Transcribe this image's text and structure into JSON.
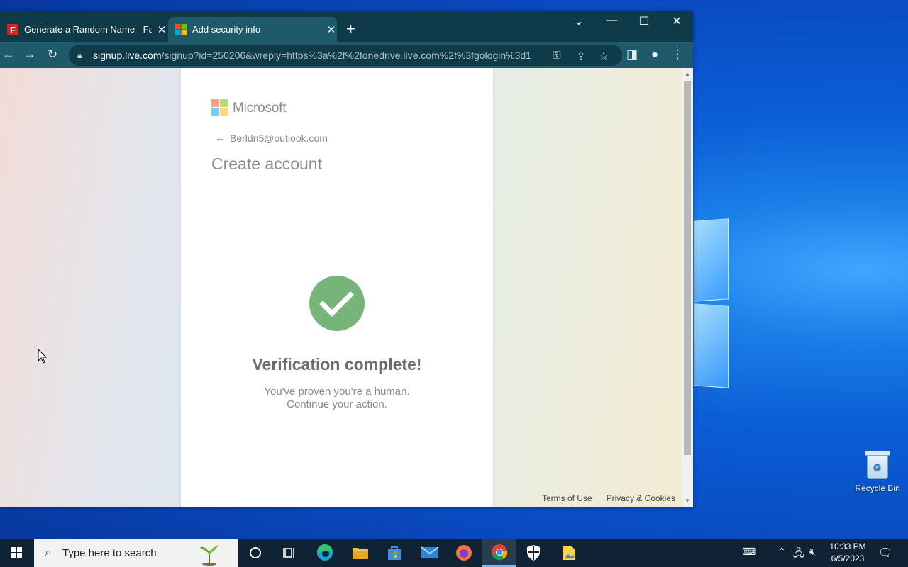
{
  "browser": {
    "tabs": [
      {
        "title": "Generate a Random Name - Fake",
        "favicon": "fakenamegenerator-icon",
        "active": false
      },
      {
        "title": "Add security info",
        "favicon": "microsoft-icon",
        "active": true
      }
    ],
    "url_host": "signup.live.com",
    "url_rest": "/signup?id=250206&wreply=https%3a%2f%2fonedrive.live.com%2f%3fgologin%3d1..."
  },
  "page": {
    "brand": "Microsoft",
    "email": "Berldn5@outlook.com",
    "title": "Create account",
    "verify_title": "Verification complete!",
    "verify_line1": "You've proven you're a human.",
    "verify_line2": "Continue your action.",
    "footer_terms": "Terms of Use",
    "footer_privacy": "Privacy & Cookies",
    "check_color": "#76b47a"
  },
  "desktop": {
    "recycle_bin_label": "Recycle Bin"
  },
  "taskbar": {
    "search_placeholder": "Type here to search",
    "time": "10:33 PM",
    "date": "6/5/2023",
    "apps": [
      "cortana-icon",
      "task-view-icon",
      "edge-icon",
      "file-explorer-icon",
      "store-icon",
      "mail-icon",
      "firefox-icon",
      "chrome-icon",
      "security-icon",
      "app-icon"
    ]
  },
  "colors": {
    "tabstrip": "#0e3a49",
    "toolbar": "#1f5a6a",
    "taskbar": "#0f2335",
    "ms_red": "#f25022",
    "ms_green": "#7fba00",
    "ms_blue": "#00a4ef",
    "ms_yellow": "#ffb900"
  }
}
